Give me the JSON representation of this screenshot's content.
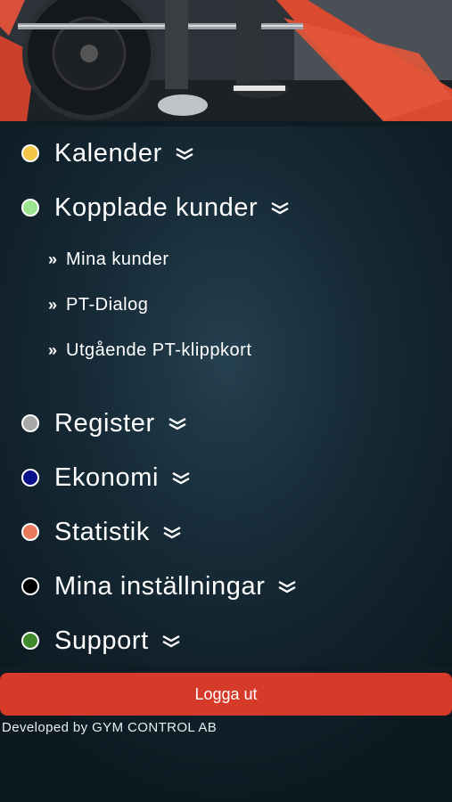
{
  "menu": {
    "items": [
      {
        "label": "Kalender",
        "color": "#f5c545",
        "icon": "chevron-double-down-icon"
      },
      {
        "label": "Kopplade kunder",
        "color": "#9be58f",
        "icon": "chevron-double-down-icon"
      },
      {
        "label": "Register",
        "color": "#a8a8a8",
        "icon": "chevron-double-down-icon"
      },
      {
        "label": "Ekonomi",
        "color": "#0a0f8a",
        "icon": "chevron-double-down-icon"
      },
      {
        "label": "Statistik",
        "color": "#ea7a5c",
        "icon": "chevron-double-down-icon"
      },
      {
        "label": "Mina inställningar",
        "color": "#000000",
        "icon": "chevron-double-down-icon"
      },
      {
        "label": "Support",
        "color": "#3f8a2a",
        "icon": "chevron-double-down-icon"
      }
    ],
    "subitems": [
      {
        "bullet": "»",
        "label": "Mina kunder"
      },
      {
        "bullet": "»",
        "label": "PT-Dialog"
      },
      {
        "bullet": "»",
        "label": "Utgående PT-klippkort"
      }
    ]
  },
  "logout": {
    "label": "Logga ut",
    "color": "#d63a28"
  },
  "footer": {
    "text": "Developed by GYM CONTROL AB"
  }
}
